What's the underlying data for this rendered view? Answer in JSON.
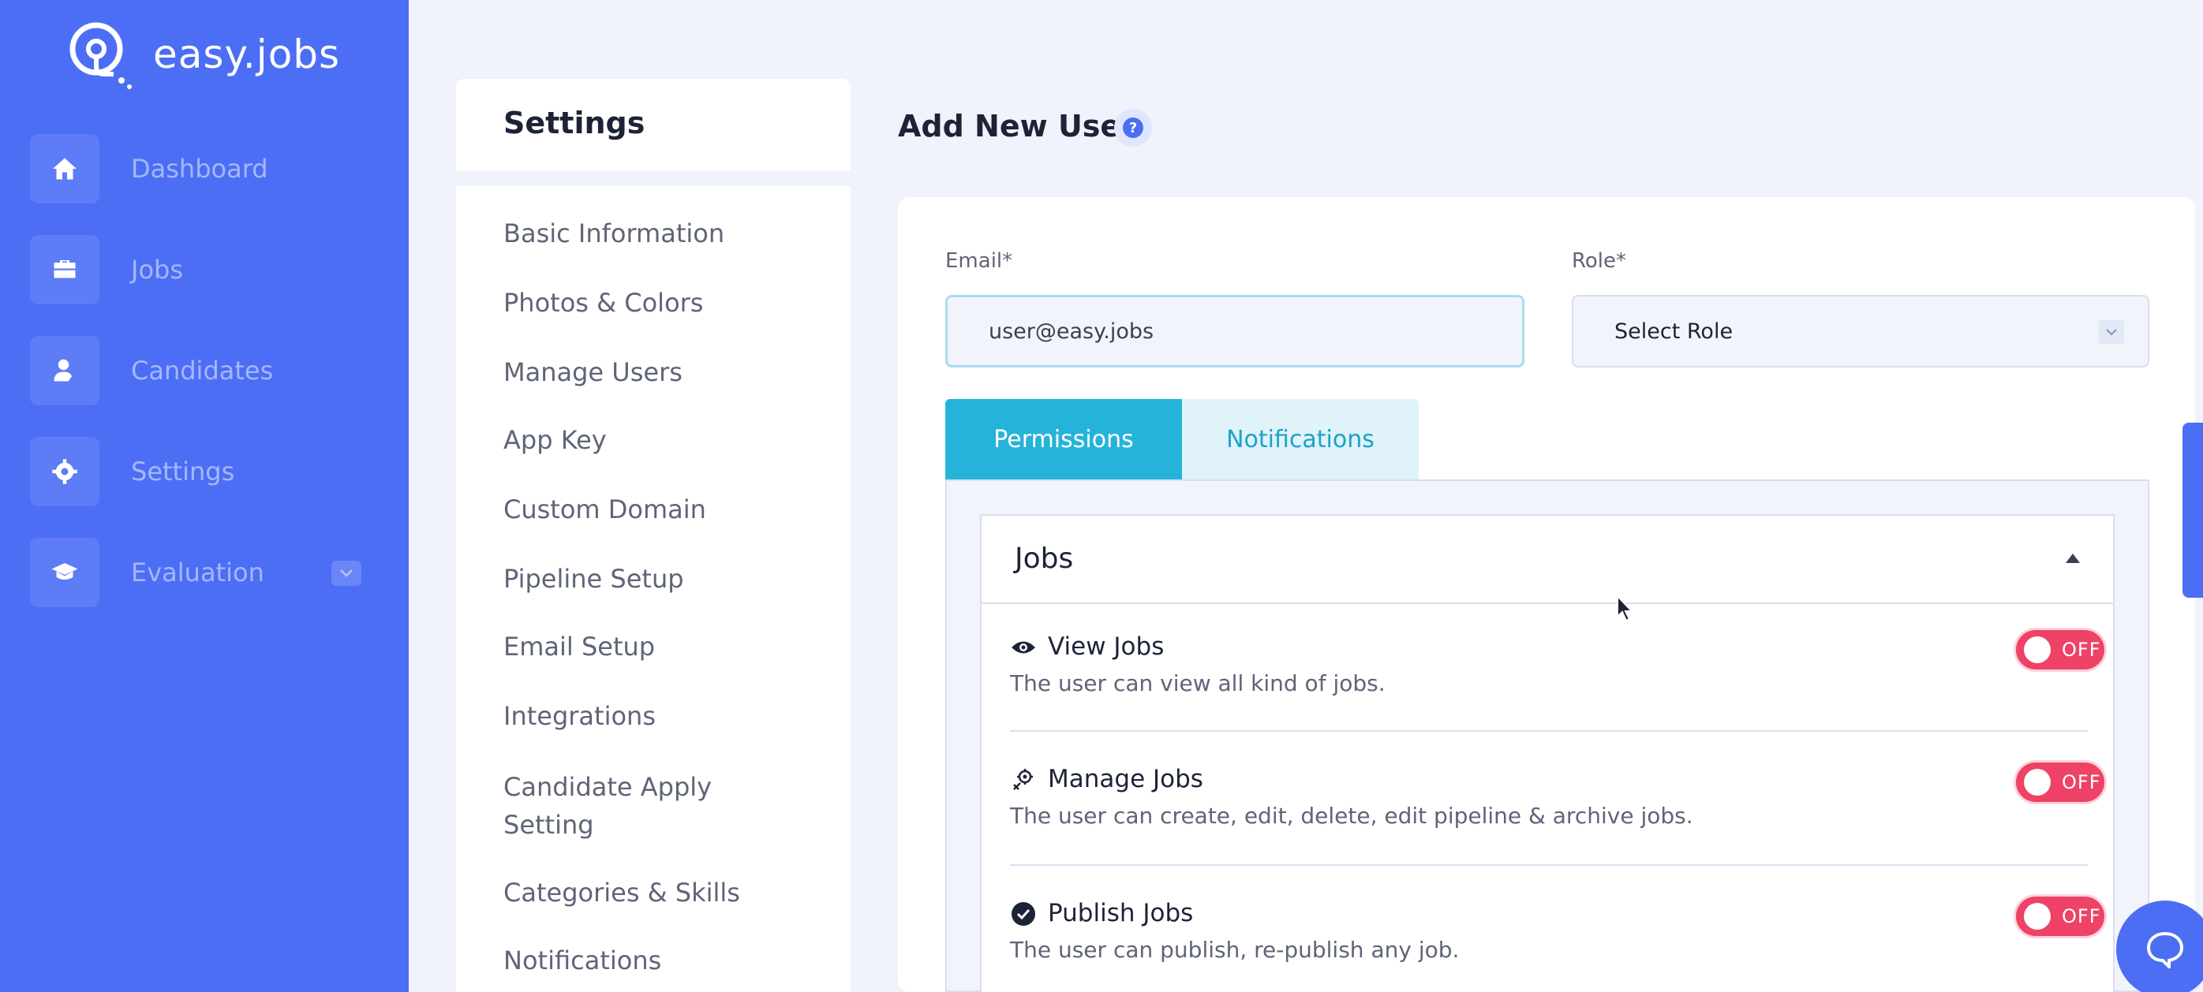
{
  "brand": {
    "name": "easy.jobs"
  },
  "sidebar": {
    "items": [
      {
        "label": "Dashboard",
        "icon": "home-icon"
      },
      {
        "label": "Jobs",
        "icon": "briefcase-icon"
      },
      {
        "label": "Candidates",
        "icon": "user-icon"
      },
      {
        "label": "Settings",
        "icon": "gear-icon"
      },
      {
        "label": "Evaluation",
        "icon": "graduation-cap-icon"
      }
    ]
  },
  "settings_menu": {
    "title": "Settings",
    "items": [
      "Basic Information",
      "Photos & Colors",
      "Manage Users",
      "App Key",
      "Custom Domain",
      "Pipeline Setup",
      "Email Setup",
      "Integrations",
      "Candidate Apply Setting",
      "Categories & Skills",
      "Notifications"
    ]
  },
  "main": {
    "title": "Add New User",
    "help_icon": "question-icon",
    "email": {
      "label": "Email*",
      "value": "user@easy.jobs"
    },
    "role": {
      "label": "Role*",
      "value": "Select Role"
    },
    "tabs": [
      {
        "label": "Permissions",
        "active": true
      },
      {
        "label": "Notifications",
        "active": false
      }
    ],
    "section": {
      "title": "Jobs",
      "permissions": [
        {
          "title": "View Jobs",
          "description": "The user can view all kind of jobs.",
          "state": "OFF",
          "icon": "eye-icon"
        },
        {
          "title": "Manage Jobs",
          "description": "The user can create, edit, delete, edit pipeline & archive jobs.",
          "state": "OFF",
          "icon": "manage-icon"
        },
        {
          "title": "Publish Jobs",
          "description": "The user can publish, re-publish any job.",
          "state": "OFF",
          "icon": "check-circle-icon"
        }
      ]
    }
  },
  "colors": {
    "sidebar": "#4c6ef5",
    "tab_active": "#26b3d9",
    "toggle_off": "#ee4266"
  }
}
